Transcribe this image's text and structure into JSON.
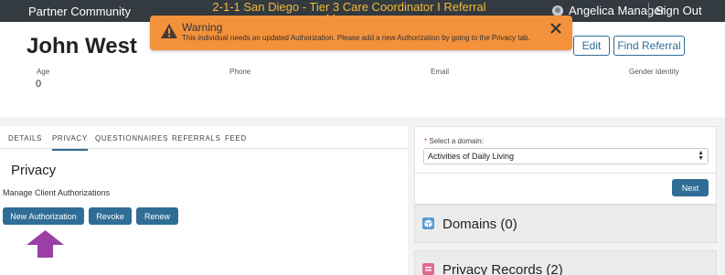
{
  "topbar": {
    "brand": "Partner Community",
    "app_title": "2-1-1 San Diego - Tier 3 Care Coordinator I Referral Manager",
    "user_name": "Angelica Manager",
    "sign_out": "Sign Out"
  },
  "toast": {
    "title": "Warning",
    "message": "This individual needs an updated Authorization. Please add a new Authorization by going to the Privacy tab.",
    "color": "#f4913b"
  },
  "client": {
    "name": "John West",
    "edit_label": "Edit",
    "find_referral_label": "Find Referral",
    "fields": [
      {
        "label": "Age",
        "value": "0"
      },
      {
        "label": "Phone",
        "value": ""
      },
      {
        "label": "Email",
        "value": ""
      },
      {
        "label": "Gender Identity",
        "value": ""
      }
    ]
  },
  "tabs": [
    {
      "label": "DETAILS",
      "active": false
    },
    {
      "label": "PRIVACY",
      "active": true
    },
    {
      "label": "QUESTIONNAIRES",
      "active": false
    },
    {
      "label": "REFERRALS",
      "active": false
    },
    {
      "label": "FEED",
      "active": false
    }
  ],
  "privacy": {
    "title": "Privacy",
    "manage_label": "Manage Client Authorizations",
    "new_authorization": "New Authorization",
    "revoke": "Revoke",
    "renew": "Renew"
  },
  "domain_card": {
    "required_marker": "*",
    "select_label": "Select a domain:",
    "selected": "Activities of Daily Living",
    "next_label": "Next"
  },
  "sections": {
    "domains": "Domains (0)",
    "privacy_records": "Privacy Records (2)"
  },
  "colors": {
    "accent": "#2f6d96",
    "topbar": "#333a40",
    "app_title": "#f1b93a",
    "arrow": "#9b3fa6"
  }
}
